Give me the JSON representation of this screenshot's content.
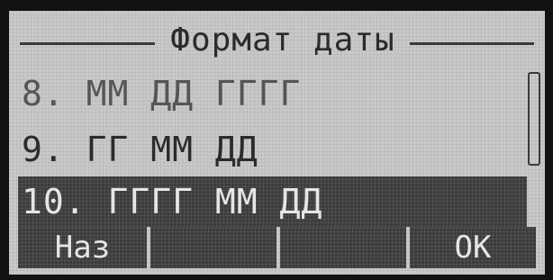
{
  "screen": {
    "title": "Формат даты"
  },
  "list": {
    "items": [
      {
        "label": "8. ММ ДД ГГГГ",
        "selected": false
      },
      {
        "label": "9. ГГ ММ ДД",
        "selected": false
      },
      {
        "label": "10. ГГГГ ММ ДД",
        "selected": true
      }
    ]
  },
  "softkeys": {
    "back_label": "Наз",
    "key2_label": "",
    "key3_label": "",
    "ok_label": "OK"
  },
  "colors": {
    "screen_background": "#c9c9c9",
    "selection_background": "#3c3c3c",
    "text": "#2b2b2b",
    "text_inverted": "#e6e6e6"
  }
}
